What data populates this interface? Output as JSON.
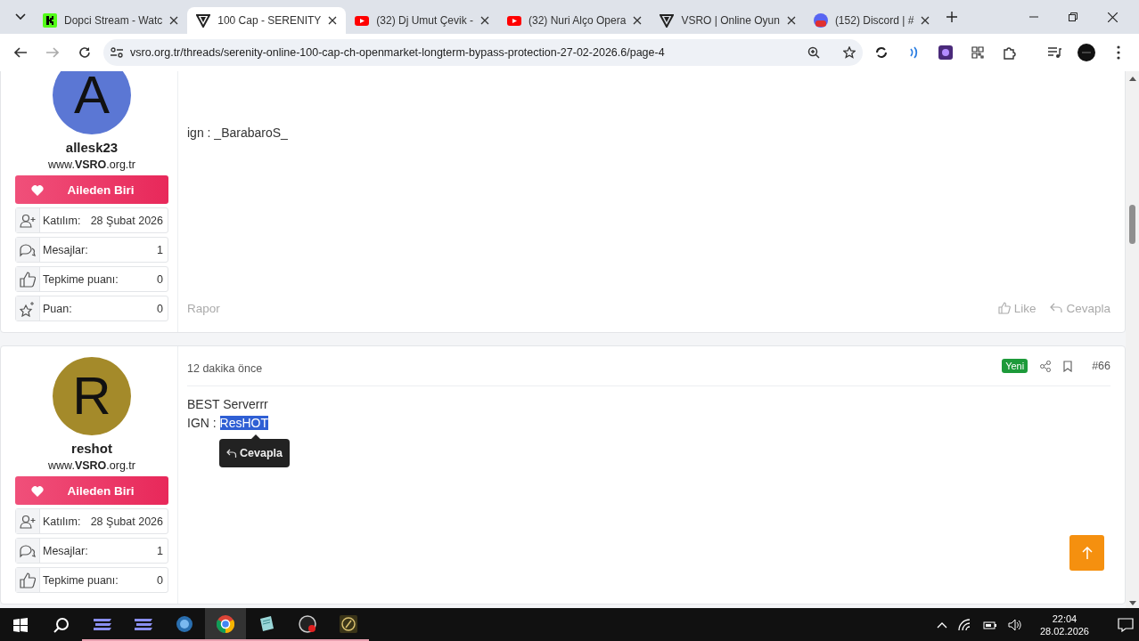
{
  "browser": {
    "tabs": [
      {
        "title": "Dopci Stream - Watc",
        "kind": "kick",
        "selected": false
      },
      {
        "title": "100 Cap - SERENITY",
        "kind": "vsro",
        "selected": true
      },
      {
        "title": "(32) Dj Umut Çevik -",
        "kind": "youtube",
        "selected": false
      },
      {
        "title": "(32) Nuri Alço Opera",
        "kind": "youtube",
        "selected": false
      },
      {
        "title": "VSRO | Online Oyun",
        "kind": "vsro",
        "selected": false
      },
      {
        "title": "(152) Discord | #",
        "kind": "discord",
        "selected": false
      }
    ],
    "url": "vsro.org.tr/threads/serenity-online-100-cap-ch-openmarket-longterm-bypass-protection-27-02-2026.6/page-4"
  },
  "posts": [
    {
      "user": {
        "name": "allesk23",
        "avatar_letter": "A",
        "color": "#5b77d4",
        "site": "www.**VSRO**.org.tr",
        "banner": "Aileden Biri",
        "stats": [
          {
            "kind": "joined",
            "label": "Katılım:",
            "value": "28 Şubat 2026"
          },
          {
            "kind": "messages",
            "label": "Mesajlar:",
            "value": "1"
          },
          {
            "kind": "reactions",
            "label": "Tepkime puanı:",
            "value": "0"
          },
          {
            "kind": "points",
            "label": "Puan:",
            "value": "0"
          }
        ]
      },
      "lines": [
        {
          "text": "ign : _BarabaroS_"
        }
      ],
      "footer": {
        "report": "Rapor",
        "actions": [
          {
            "kind": "like",
            "label": "Like"
          },
          {
            "kind": "reply",
            "label": "Cevapla"
          }
        ]
      }
    },
    {
      "user": {
        "name": "reshot",
        "avatar_letter": "R",
        "color": "#a48a2a",
        "site": "www.**VSRO**.org.tr",
        "banner": "Aileden Biri",
        "stats": [
          {
            "kind": "joined",
            "label": "Katılım:",
            "value": "28 Şubat 2026"
          },
          {
            "kind": "messages",
            "label": "Mesajlar:",
            "value": "1"
          },
          {
            "kind": "reactions",
            "label": "Tepkime puanı:",
            "value": "0"
          }
        ]
      },
      "header": {
        "time": "12 dakika önce",
        "badge": "Yeni",
        "number": "#66"
      },
      "lines": [
        {
          "text": "BEST Serverrr"
        },
        {
          "text": "IGN : ",
          "selected_text": "ResHOT"
        }
      ],
      "tooltip": "Cevapla"
    }
  ],
  "taskbar": {
    "time": "22:04",
    "date": "28.02.2026"
  }
}
